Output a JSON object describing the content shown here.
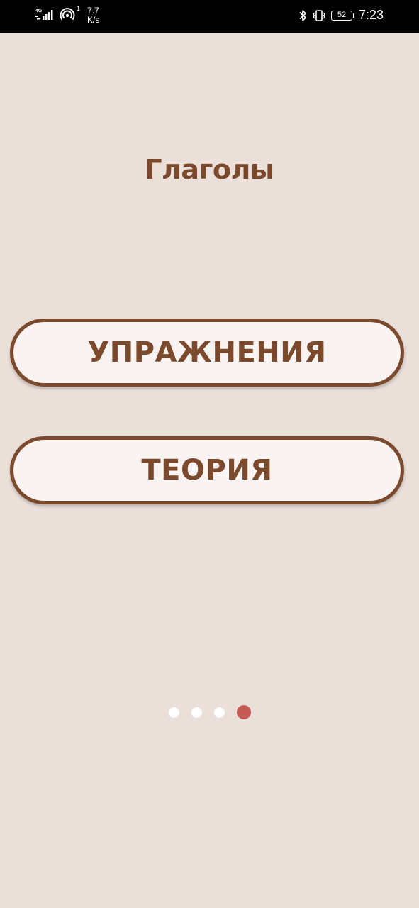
{
  "status_bar": {
    "network_type": "4G",
    "network_speed_value": "7.7",
    "network_speed_unit": "K/s",
    "hotspot_badge": "1",
    "battery_level": "52",
    "time": "7:23"
  },
  "screen": {
    "title": "Глаголы",
    "buttons": {
      "exercises": "УПРАЖНЕНИЯ",
      "theory": "ТЕОРИЯ"
    }
  },
  "pager": {
    "page_count": 4,
    "active_page": 4,
    "active_color": "#c55a55",
    "inactive_color": "#ffffff"
  },
  "colors": {
    "background": "#ebdfd9",
    "accent_brown": "#7b4a2d",
    "button_fill": "#f9f3f1"
  },
  "icons": [
    "signal-icon",
    "hotspot-icon",
    "bluetooth-icon",
    "vibrate-icon",
    "battery-icon"
  ]
}
